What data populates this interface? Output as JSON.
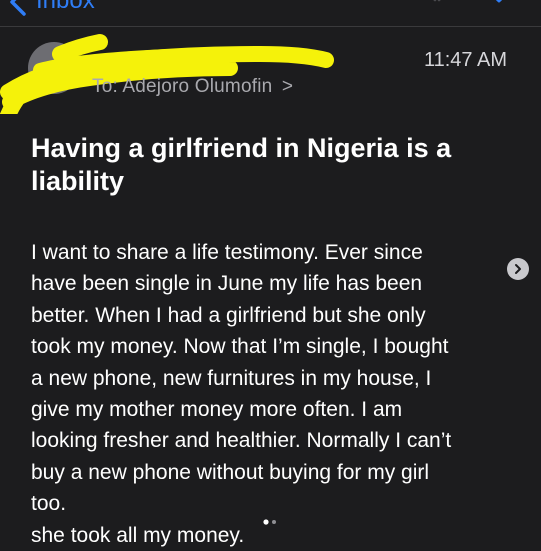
{
  "nav": {
    "back_label": "Inbox"
  },
  "header": {
    "time": "11:47 AM",
    "to_prefix": "To:",
    "to_name": "Adejoro Olumofin",
    "to_chevron": ">"
  },
  "email": {
    "subject": "Having a girlfriend in Nigeria is a liability",
    "body_lines": [
      "I want to share a life testimony. Ever since",
      "have been single in June my life has been",
      "better. When I had a girlfriend  but she only",
      "took my money. Now that I’m single, I bought",
      "a new phone, new furnitures in my house, I",
      "give my mother money more often. I am",
      "looking fresher and healthier. Normally I can’t",
      "buy a new phone without buying for my girl",
      "too.",
      "she took all my money."
    ]
  },
  "colors": {
    "background": "#1c1c1e",
    "accent": "#2f7df6",
    "redaction": "#f5f20a"
  }
}
